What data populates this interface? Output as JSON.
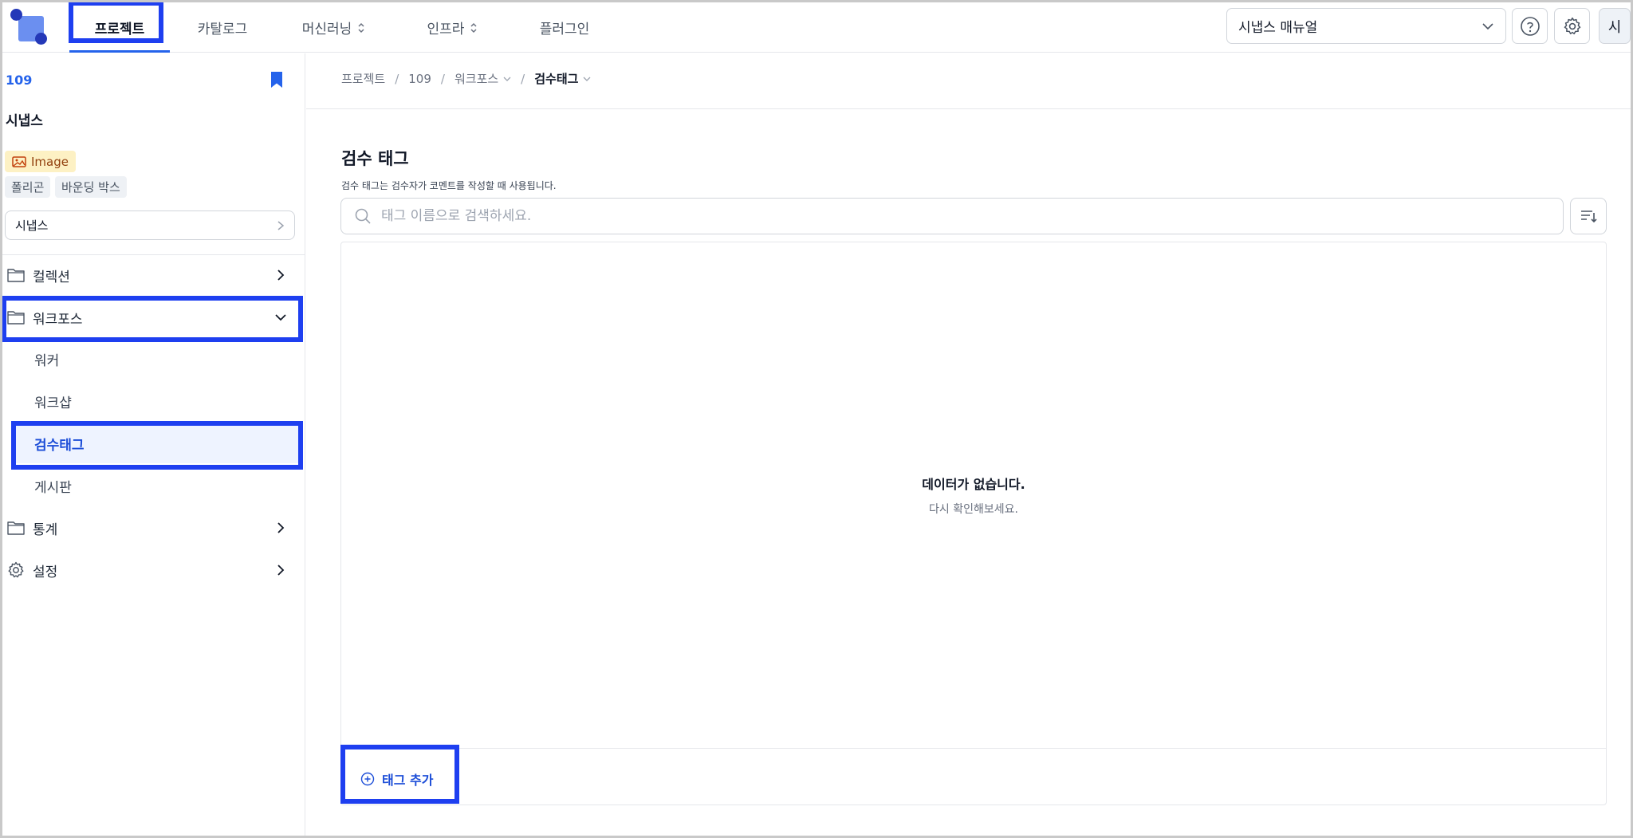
{
  "topnav": {
    "tabs": [
      {
        "label": "프로젝트",
        "active": true
      },
      {
        "label": "카탈로그"
      },
      {
        "label": "머신러닝"
      },
      {
        "label": "인프라"
      },
      {
        "label": "플러그인"
      }
    ],
    "manual_select": "시냅스 매뉴얼",
    "help_icon": "question-circle-icon",
    "settings_icon": "gear-icon",
    "avatar_initial": "시"
  },
  "sidebar": {
    "project_id": "109",
    "project_name": "시냅스",
    "data_type_badge": "Image",
    "annotation_chips": [
      "폴리곤",
      "바운딩 박스"
    ],
    "workspace_select": "시냅스",
    "menu": {
      "collection": "컬렉션",
      "workforce": "워크포스",
      "workforce_items": [
        "워커",
        "워크샵",
        "검수태그",
        "게시판"
      ],
      "stats": "통계",
      "settings": "설정"
    }
  },
  "breadcrumb": {
    "items": [
      "프로젝트",
      "109",
      "워크포스",
      "검수태그"
    ],
    "separator": "/"
  },
  "main": {
    "title": "검수 태그",
    "description": "검수 태그는 검수자가 코멘트를 작성할 때 사용됩니다.",
    "search_placeholder": "태그 이름으로 검색하세요.",
    "empty_title": "데이터가 없습니다.",
    "empty_subtitle": "다시 확인해보세요.",
    "add_tag_label": "태그 추가"
  },
  "colors": {
    "accent": "#2563eb",
    "highlight_box": "#1e3ff0",
    "image_badge_bg": "#fdf1c4"
  }
}
